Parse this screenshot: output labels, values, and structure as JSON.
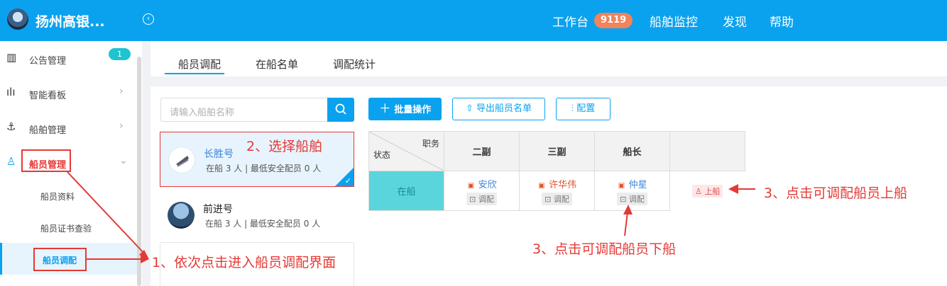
{
  "header": {
    "app_title": "扬州高银...",
    "workbench": "工作台",
    "workbench_badge": "9119",
    "ship_monitor": "船舶监控",
    "discover": "发现",
    "help": "帮助"
  },
  "sidebar": {
    "notice": "公告管理",
    "notice_badge": "1",
    "dashboard": "智能看板",
    "ship_mgmt": "船舶管理",
    "crew_mgmt": "船员管理",
    "crew_profile": "船员资料",
    "crew_cert": "船员证书查验",
    "crew_dispatch": "船员调配"
  },
  "tabs": [
    "船员调配",
    "在船名单",
    "调配统计"
  ],
  "search": {
    "placeholder": "请输入船舶名称"
  },
  "ships": [
    {
      "name": "长胜号",
      "meta": "在船 3 人 | 最低安全配员 0 人"
    },
    {
      "name": "前进号",
      "meta": "在船 3 人 | 最低安全配员 0 人"
    }
  ],
  "toolbar": {
    "batch": "批量操作",
    "export": "导出船员名单",
    "config": "配置"
  },
  "grid": {
    "corner_top": "职务",
    "corner_bottom": "状态",
    "headers": [
      "二副",
      "三副",
      "船长"
    ],
    "status": "在船",
    "crew": [
      {
        "name": "安欣",
        "tag": "调配"
      },
      {
        "name": "许华伟",
        "tag": "调配"
      },
      {
        "name": "仲星",
        "tag": "调配"
      }
    ],
    "onboard": "上船"
  },
  "annotations": {
    "step1": "1、依次点击进入船员调配界面",
    "step2": "2、选择船舶",
    "step3_up": "3、点击可调配船员上船",
    "step3_down": "3、点击可调配船员下船"
  },
  "colors": {
    "primary": "#0aa2ef",
    "annotation": "#e53935",
    "status_cell": "#5bd5dc"
  }
}
